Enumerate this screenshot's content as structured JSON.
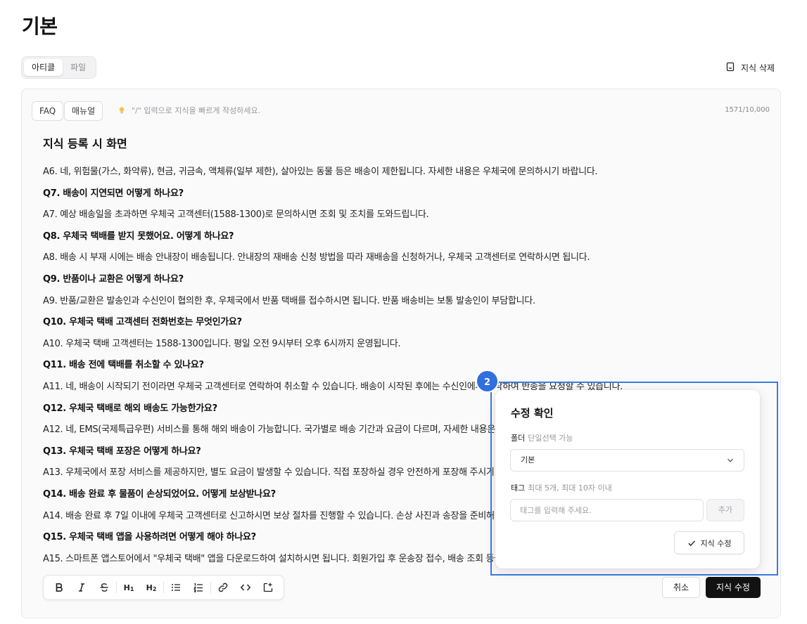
{
  "page": {
    "title": "기본"
  },
  "tabs": [
    {
      "label": "아티클",
      "active": true
    },
    {
      "label": "파일",
      "active": false
    }
  ],
  "header_actions": {
    "delete_label": "지식 삭제"
  },
  "editor": {
    "type_buttons": [
      "FAQ",
      "매뉴얼"
    ],
    "hint": "\"/\" 입력으로 지식을 빠르게 작성하세요.",
    "counter": "1571/10,000",
    "doc_title": "지식 등록 시 화면",
    "lines": [
      {
        "text": "A6. 네, 위험물(가스, 화약류), 현금, 귀금속, 액체류(일부 제한), 살아있는 동물 등은 배송이 제한됩니다. 자세한 내용은 우체국에 문의하시기 바랍니다.",
        "bold": false
      },
      {
        "text": "Q7. 배송이 지연되면 어떻게 하나요?",
        "bold": true
      },
      {
        "text": "A7. 예상 배송일을 초과하면 우체국 고객센터(1588-1300)로 문의하시면 조회 및 조치를 도와드립니다.",
        "bold": false
      },
      {
        "text": "Q8. 우체국 택배를 받지 못했어요. 어떻게 하나요?",
        "bold": true
      },
      {
        "text": "A8. 배송 시 부재 시에는 배송 안내장이 배송됩니다. 안내장의 재배송 신청 방법을 따라 재배송을 신청하거나, 우체국 고객센터로 연락하시면 됩니다.",
        "bold": false
      },
      {
        "text": "Q9. 반품이나 교환은 어떻게 하나요?",
        "bold": true
      },
      {
        "text": "A9. 반품/교환은 발송인과 수신인이 협의한 후, 우체국에서 반품 택배를 접수하시면 됩니다. 반품 배송비는 보통 발송인이 부담합니다.",
        "bold": false
      },
      {
        "text": "Q10. 우체국 택배 고객센터 전화번호는 무엇인가요?",
        "bold": true
      },
      {
        "text": "A10. 우체국 택배 고객센터는 1588-1300입니다. 평일 오전 9시부터 오후 6시까지 운영됩니다.",
        "bold": false
      },
      {
        "text": "Q11. 배송 전에 택배를 취소할 수 있나요?",
        "bold": true
      },
      {
        "text": "A11. 네, 배송이 시작되기 전이라면 우체국 고객센터로 연락하여 취소할 수 있습니다. 배송이 시작된 후에는 수신인에게 연락하여 반송을 요청할 수 있습니다.",
        "bold": false
      },
      {
        "text": "Q12. 우체국 택배로 해외 배송도 가능한가요?",
        "bold": true
      },
      {
        "text": "A12. 네, EMS(국제특급우편) 서비스를 통해 해외 배송이 가능합니다. 국가별로 배송 기간과 요금이 다르며, 자세한 내용은 우체국에 문의하시기 바랍니다.",
        "bold": false
      },
      {
        "text": "Q13. 우체국 택배 포장은 어떻게 하나요?",
        "bold": true
      },
      {
        "text": "A13. 우체국에서 포장 서비스를 제공하지만, 별도 요금이 발생할 수 있습니다. 직접 포장하실 경우 안전하게 포장해 주시기 바랍니다.",
        "bold": false
      },
      {
        "text": "Q14. 배송 완료 후 물품이 손상되었어요. 어떻게 보상받나요?",
        "bold": true
      },
      {
        "text": "A14. 배송 완료 후 7일 이내에 우체국 고객센터로 신고하시면 보상 절차를 진행할 수 있습니다. 손상 사진과 송장을 준비해 주세요.",
        "bold": false
      },
      {
        "text": "Q15. 우체국 택배 앱을 사용하려면 어떻게 해야 하나요?",
        "bold": true
      },
      {
        "text": "A15. 스마트폰 앱스토어에서 \"우체국 택배\" 앱을 다운로드하여 설치하시면 됩니다. 회원가입 후 운송장 접수, 배송 조회 등을 이용할 수 있습니다.",
        "bold": false
      }
    ],
    "format_tools": [
      "bold",
      "italic",
      "strikethrough",
      "heading-1",
      "heading-2",
      "bullet-list",
      "ordered-list",
      "link",
      "code",
      "embed"
    ],
    "heading1_label": "H",
    "heading1_sub": "1",
    "heading2_label": "H",
    "heading2_sub": "2",
    "cancel_label": "취소",
    "submit_label": "지식 수정"
  },
  "step_badge": "2",
  "popup": {
    "title": "수정 확인",
    "folder_label": "폴더",
    "folder_hint": "단일선택 가능",
    "folder_value": "기본",
    "tag_label": "태그",
    "tag_hint": "최대 5개, 최대 10자 이내",
    "tag_placeholder": "태그를 입력해 주세요.",
    "add_label": "추가",
    "confirm_label": "지식 수정"
  },
  "colors": {
    "accent": "#2f6fe0",
    "primary_button": "#121212"
  }
}
